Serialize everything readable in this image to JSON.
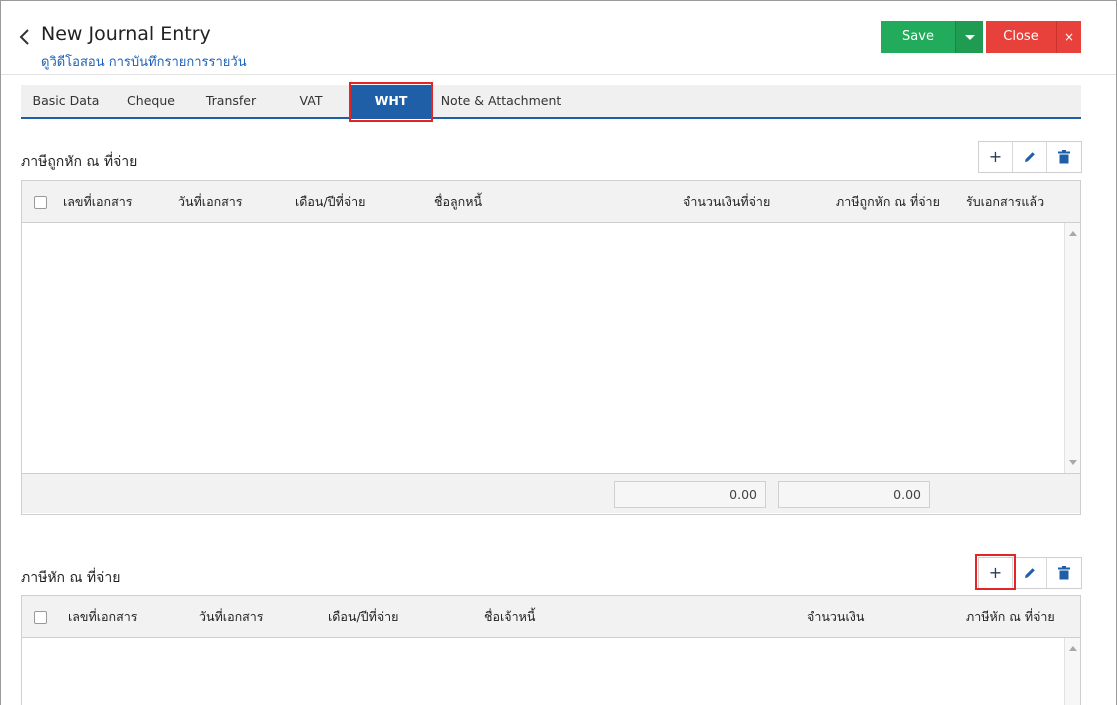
{
  "header": {
    "title": "New Journal Entry",
    "subtitle": "ดูวิดีโอสอน การบันทึกรายการรายวัน",
    "save_label": "Save",
    "close_label": "Close",
    "close_x": "×"
  },
  "tabs": [
    {
      "label": "Basic Data"
    },
    {
      "label": "Cheque"
    },
    {
      "label": "Transfer"
    },
    {
      "label": "VAT"
    },
    {
      "label": "WHT",
      "active": true
    },
    {
      "label": "Note & Attachment"
    }
  ],
  "section1": {
    "title": "ภาษีถูกหัก ณ ที่จ่าย",
    "columns": [
      "เลขที่เอกสาร",
      "วันที่เอกสาร",
      "เดือน/ปีที่จ่าย",
      "ชื่อลูกหนี้",
      "จำนวนเงินที่จ่าย",
      "ภาษีถูกหัก ณ ที่จ่าย",
      "รับเอกสารแล้ว"
    ],
    "rows": [],
    "totals": {
      "amount": "0.00",
      "tax": "0.00"
    }
  },
  "section2": {
    "title": "ภาษีหัก ณ ที่จ่าย",
    "columns": [
      "เลขที่เอกสาร",
      "วันที่เอกสาร",
      "เดือน/ปีที่จ่าย",
      "ชื่อเจ้าหนี้",
      "จำนวนเงิน",
      "ภาษีหัก ณ ที่จ่าย"
    ],
    "rows": []
  },
  "icons": {
    "back": "chevron-left-icon",
    "caret": "caret-down-icon",
    "add": "plus-icon",
    "edit": "pencil-icon",
    "delete": "trash-icon"
  },
  "colors": {
    "save": "#22ab5a",
    "close": "#e8403a",
    "accent": "#1f5fa8",
    "highlight": "#e52525"
  }
}
